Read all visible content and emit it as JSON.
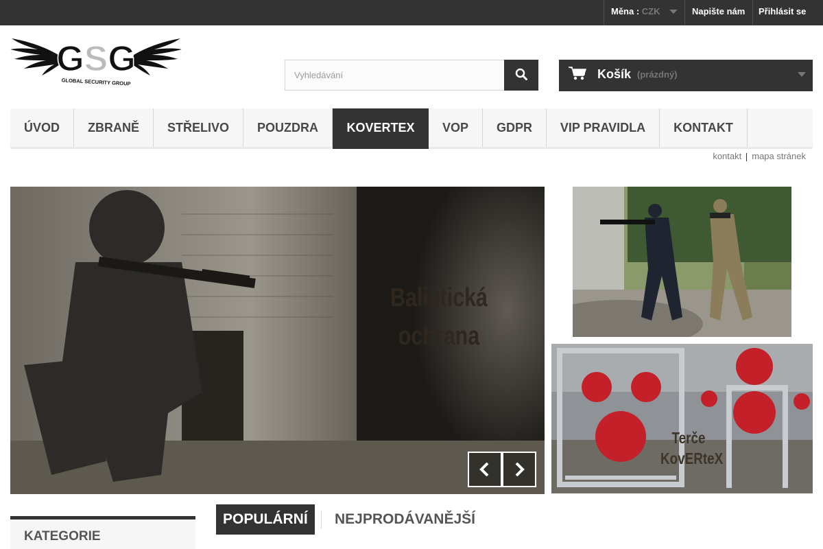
{
  "topbar": {
    "currency_label": "Měna :",
    "currency_value": "CZK",
    "contact": "Napište nám",
    "login": "Přihlásit se"
  },
  "logo": {
    "letters": "GSG",
    "tagline": "GLOBAL SECURITY GROUP"
  },
  "search": {
    "placeholder": "Vyhledávání",
    "value": "",
    "icon": "search-icon"
  },
  "cart": {
    "label": "Košík",
    "status": "(prázdný)",
    "icon": "cart-icon"
  },
  "menu": {
    "items": [
      {
        "label": "ÚVOD"
      },
      {
        "label": "ZBRANĚ"
      },
      {
        "label": "STŘELIVO"
      },
      {
        "label": "POUZDRA"
      },
      {
        "label": "KOVERTEX"
      },
      {
        "label": "VOP"
      },
      {
        "label": "GDPR"
      },
      {
        "label": "VIP PRAVIDLA"
      },
      {
        "label": "KONTAKT"
      }
    ],
    "active": "KOVERTEX"
  },
  "links": {
    "contact": "kontakt",
    "sitemap": "mapa stránek"
  },
  "slider": {
    "caption_line1": "Balistická",
    "caption_line2": "ochrana"
  },
  "banners": {
    "banner2_line1": "Terče",
    "banner2_line2": "KovERteX"
  },
  "sidebar": {
    "title": "KATEGORIE"
  },
  "tabs": {
    "popular": "POPULÁRNÍ",
    "bestsellers": "NEJPRODÁVANĚJŠÍ"
  },
  "colors": {
    "dark": "#333333",
    "menu_bg": "#f6f6f6",
    "target_red": "#c4202a"
  }
}
